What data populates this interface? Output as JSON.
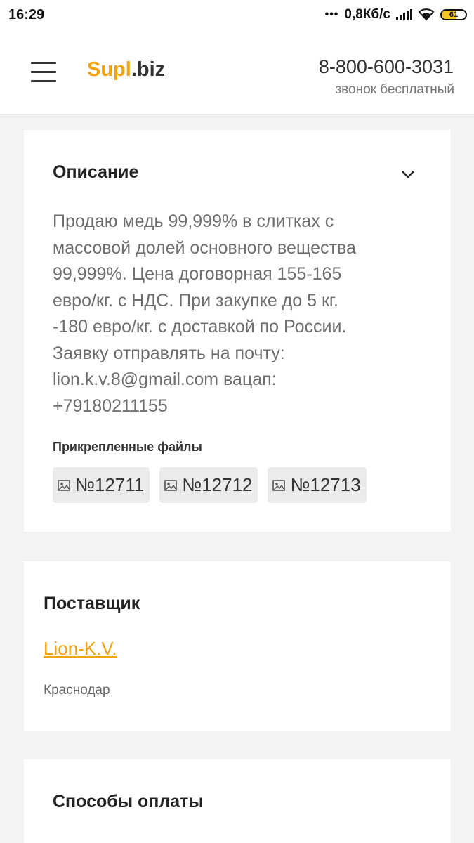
{
  "status_bar": {
    "time": "16:29",
    "network_speed": "0,8Кб/с",
    "battery_level": "61",
    "battery_fraction": 0.61
  },
  "header": {
    "logo_part1": "Supl",
    "logo_part2": ".biz",
    "phone": "8-800-600-3031",
    "phone_note": "звонок бесплатный"
  },
  "description_card": {
    "title": "Описание",
    "lines": [
      "Продаю медь 99,999% в слитках с",
      "массовой долей основного вещества",
      "99,999%. Цена договорная 155-165",
      "евро/кг. с НДС. При закупке до 5 кг.",
      "-180 евро/кг. с доставкой по России.",
      "Заявку отправлять на почту:",
      "lion.k.v.8@gmail.com вацап:",
      "+79180211155"
    ],
    "files_label": "Прикрепленные файлы",
    "files": [
      "№12711",
      "№12712",
      "№12713"
    ]
  },
  "supplier_card": {
    "title": "Поставщик",
    "name": "Lion-K.V.",
    "city": "Краснодар"
  },
  "payment_card": {
    "title": "Способы оплаты"
  },
  "colors": {
    "accent": "#f0a20f",
    "background": "#f3f3f3",
    "text_muted": "#6e6e6e"
  }
}
